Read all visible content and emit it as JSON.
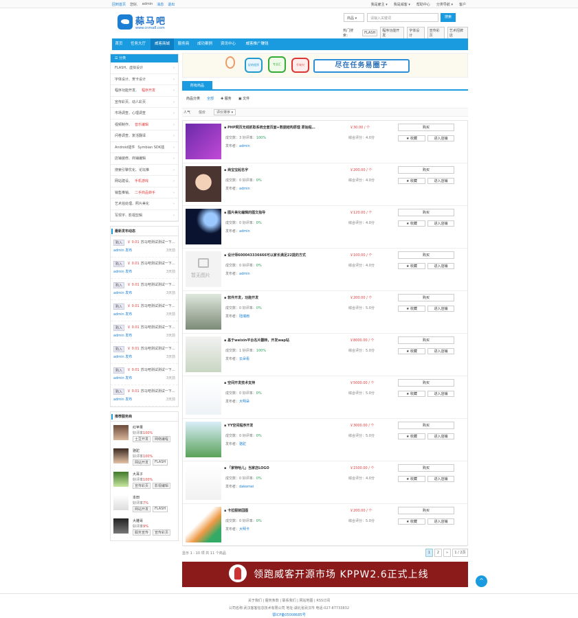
{
  "topbar": {
    "left": [
      "回到首页",
      "您好,",
      "admin",
      "消息",
      "退出"
    ],
    "right": [
      "我是雇主",
      "我是威客",
      "帮助中心",
      "分类导航",
      "客户"
    ]
  },
  "header": {
    "logo_name": "蒜马吧",
    "logo_url": "www.cnma8.com",
    "search_select": "商品 ▾",
    "search_placeholder": "请输入关键词",
    "search_button": "搜索",
    "hot_label": "热门搜索：",
    "hot_tags": [
      "FLASH",
      "程序功能开发",
      "字体设计",
      "宣传彩页",
      "艺术招牌店"
    ]
  },
  "nav": [
    "首页",
    "任务大厅",
    "威客商城",
    "服务商",
    "成功案例",
    "资讯中心",
    "威客推广赚钱"
  ],
  "sidebar": {
    "cat_head": "☰ 分类",
    "cats": [
      [
        "FLASH、虚拟设计"
      ],
      [
        "字体设计、贺卡设计"
      ],
      [
        "程序功能开发、",
        "程序开发"
      ],
      [
        "宣传彩页、动人彩页"
      ],
      [
        "市场调查、心理调查"
      ],
      [
        "视频制作、",
        "音乐编辑"
      ],
      [
        "问卷调查、复活翻译"
      ],
      [
        "Android插件",
        "Symbian SDK插"
      ],
      [
        "店铺装修、商铺编辑"
      ],
      [
        "搜索引擎优化、论坛推"
      ],
      [
        "网站建设、",
        "手机游戏"
      ],
      [
        "销售推销、",
        "二手商品转手"
      ],
      [
        "艺术拍处理、照片美化"
      ],
      [
        "写现字、影视剪辑"
      ]
    ],
    "news_title": "最新发布动态",
    "news": [
      {
        "badge": "购入",
        "money": "￥ 0.01",
        "text": "苏马吧测试测试一下…",
        "who": "admin 发布",
        "when": "3天前"
      },
      {
        "badge": "购入",
        "money": "￥ 0.01",
        "text": "苏马吧测试测试一下…",
        "who": "admin 发布",
        "when": "3天前"
      },
      {
        "badge": "购入",
        "money": "￥ 0.01",
        "text": "苏马吧测试测试一下…",
        "who": "admin 发布",
        "when": "3天前"
      },
      {
        "badge": "购入",
        "money": "￥ 0.01",
        "text": "苏马吧测试测试一下…",
        "who": "admin 发布",
        "when": "3天前"
      },
      {
        "badge": "购入",
        "money": "￥ 0.01",
        "text": "苏马吧测试测试一下…",
        "who": "admin 发布",
        "when": "3天前"
      },
      {
        "badge": "购入",
        "money": "￥ 0.01",
        "text": "苏马吧测试测试一下…",
        "who": "admin 发布",
        "when": "3天前"
      },
      {
        "badge": "购入",
        "money": "￥ 0.01",
        "text": "苏马吧测试测试一下…",
        "who": "admin 发布",
        "when": "3天前"
      },
      {
        "badge": "购入",
        "money": "￥ 0.01",
        "text": "苏马吧测试测试一下…",
        "who": "admin 发布",
        "when": "3天前"
      }
    ],
    "prov_title": "推荐服务商",
    "providers": [
      {
        "name": "红苹果",
        "rate": "好评率",
        "rate_val": "100%",
        "tags": [
          "土豆开发",
          "网络编程"
        ]
      },
      {
        "name": "骆驼",
        "rate": "好评率",
        "rate_val": "100%",
        "tags": [
          "网站开发",
          "FLASH"
        ]
      },
      {
        "name": "大耳子",
        "rate": "好评率",
        "rate_val": "100%",
        "tags": [
          "宣传彩页",
          "影视编辑"
        ]
      },
      {
        "name": "本田",
        "rate": "好评率",
        "rate_val": "7%",
        "tags": [
          "网站开发",
          "FLASH"
        ]
      },
      {
        "name": "大雕哥",
        "rate": "好评率",
        "rate_val": "9%",
        "tags": [
          "服务宣传",
          "宣传彩页"
        ]
      }
    ]
  },
  "main": {
    "banner_slogan": "尽在任务易圈子",
    "bubbles": [
      "好的程序",
      "专业汇",
      "千年兴"
    ],
    "tab": "所有商品",
    "filt1": [
      "商品分类",
      "全部",
      "✚ 服务",
      "▣ 文件"
    ],
    "filt2": [
      "人气",
      "信价",
      "评价排序 ▾"
    ],
    "items": [
      {
        "title": "PHP网页无线抓取系统全套页面+数据结构原理 原始程…",
        "price": "￥30.00 / 个",
        "sold": "成交数：3",
        "rate_l": "好评率：",
        "rate": "100%",
        "score": "综合评分：4.0分",
        "pub": "发布者：",
        "user": "admin"
      },
      {
        "title": "商宝宝起名字",
        "price": "￥200.00 / 个",
        "sold": "成交数：0",
        "rate_l": "好评率：",
        "rate": "0%",
        "score": "综合评分：4.0分",
        "pub": "发布者：",
        "user": "admin"
      },
      {
        "title": "图片美化编辑的图文指导",
        "price": "￥120.00 / 个",
        "sold": "成交数：0",
        "rate_l": "好评率：",
        "rate": "0%",
        "score": "综合评分：4.0分",
        "pub": "发布者：",
        "user": "admin"
      },
      {
        "title": "设计师600043336666可以家长满足22提的方式",
        "price": "￥100.00 / 个",
        "sold": "成交数：0",
        "rate_l": "好评率：",
        "rate": "0%",
        "score": "综合评分：4.0分",
        "pub": "发布者：",
        "user": "admin"
      },
      {
        "title": "软件开发，功能开发",
        "price": "￥200.00 / 个",
        "sold": "成交数：0",
        "rate_l": "好评率：",
        "rate": "0%",
        "score": "综合评分：5.0分",
        "pub": "发布者：",
        "user": "陆瑞雨"
      },
      {
        "title": "基于weixin平台名片翻转，开发wap站",
        "price": "￥8000.00 / 个",
        "sold": "成交数：1",
        "rate_l": "好评率：",
        "rate": "100%",
        "score": "综合评分：5.0分",
        "pub": "发布者：",
        "user": "云朵看"
      },
      {
        "title": "空间开发技术支持",
        "price": "￥5000.00 / 个",
        "sold": "成交数：0",
        "rate_l": "好评率：",
        "rate": "0%",
        "score": "综合评分：5.0分",
        "pub": "发布者：",
        "user": "大明朵"
      },
      {
        "title": "YY空间程序开发",
        "price": "￥3000.00 / 个",
        "sold": "成交数：0",
        "rate_l": "好评率：",
        "rate": "0%",
        "score": "综合评分：5.0分",
        "pub": "发布者：",
        "user": "骆驼"
      },
      {
        "title": "「家特哈儿」当家店LOGO",
        "price": "￥1500.00 / 个",
        "sold": "成交数：0",
        "rate_l": "好评率：",
        "rate": "0%",
        "score": "综合评分：4.0分",
        "pub": "发布者：",
        "user": "dakemei"
      },
      {
        "title": "卡拉服装园图",
        "price": "￥200.00 / 个",
        "sold": "成交数：0",
        "rate_l": "好评率：",
        "rate": "0%",
        "score": "综合评分：5.0分",
        "pub": "发布者：",
        "user": "大明卡"
      }
    ],
    "buy": "购买",
    "fav": "★ 收藏",
    "shop": "进入店铺",
    "thumb_noimg": "暂无图片",
    "pager_info": "显示 1 - 10 项 共 11 个商品",
    "pages": [
      "1",
      "2",
      "»",
      "1 / 2页"
    ],
    "banner2": "领跑威客开源市场 KPPW2.6正式上线"
  },
  "footer": {
    "l1": "关于我们 | 服务条款 | 联系我们 | 网站地图 | RSS订阅",
    "l2": "公司名称:武汉客客信息技术有限公司 地址:湖北省武汉市 电话:027-87733832",
    "l3": "鄂ICP备05008685号"
  },
  "colors": {
    "accent": "#1a9be0",
    "price": "#e03c3c",
    "link": "#1a7fd4"
  }
}
